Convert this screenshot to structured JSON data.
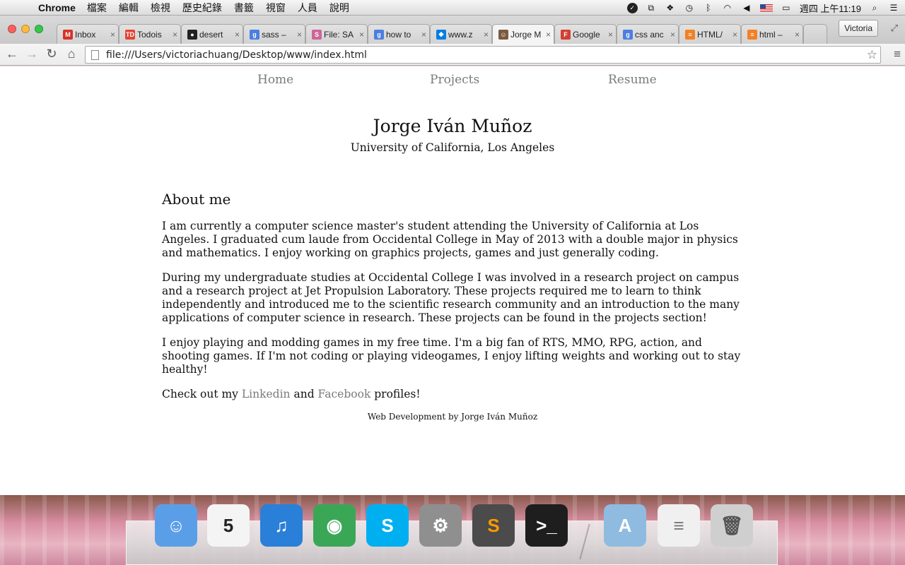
{
  "menubar": {
    "app_name": "Chrome",
    "items": [
      "檔案",
      "編輯",
      "檢視",
      "歷史紀錄",
      "書籤",
      "視窗",
      "人員",
      "說明"
    ],
    "clock": "週四 上午11:19"
  },
  "tabs": [
    {
      "label": "Inbox",
      "icon": "gmail-icon",
      "color": "#d93025",
      "glyph": "M"
    },
    {
      "label": "Todois",
      "icon": "todoist-icon",
      "color": "#e44332",
      "glyph": "TD"
    },
    {
      "label": "desert",
      "icon": "github-icon",
      "color": "#222222",
      "glyph": "●"
    },
    {
      "label": "sass –",
      "icon": "google-icon",
      "color": "#4a7fe0",
      "glyph": "g"
    },
    {
      "label": "File: SA",
      "icon": "sass-icon",
      "color": "#cf649a",
      "glyph": "S"
    },
    {
      "label": "how to",
      "icon": "google-icon",
      "color": "#4a7fe0",
      "glyph": "g"
    },
    {
      "label": "www.z",
      "icon": "dropbox-icon",
      "color": "#007ee5",
      "glyph": "◆"
    },
    {
      "label": "Jorge M",
      "icon": "avatar-icon",
      "color": "#7a5a40",
      "glyph": "☺"
    },
    {
      "label": "Google",
      "icon": "google-fonts-icon",
      "color": "#d23f31",
      "glyph": "F"
    },
    {
      "label": "css anc",
      "icon": "google-icon",
      "color": "#4a7fe0",
      "glyph": "g"
    },
    {
      "label": "HTML/",
      "icon": "stackoverflow-icon",
      "color": "#f48024",
      "glyph": "≡"
    },
    {
      "label": "html –",
      "icon": "stackoverflow-icon",
      "color": "#f48024",
      "glyph": "≡"
    }
  ],
  "profile_name": "Victoria",
  "address": "file:///Users/victoriachuang/Desktop/www/index.html",
  "site": {
    "nav": [
      "Home",
      "Projects",
      "Resume"
    ],
    "name": "Jorge Iván Muñoz",
    "school": "University of California, Los Angeles",
    "about_heading": "About me",
    "paragraphs": [
      "I am currently a computer science master's student attending the University of California at Los Angeles. I graduated cum laude from Occidental College in May of 2013 with a double major in physics and mathematics. I enjoy working on graphics projects, games and just generally coding.",
      "During my undergraduate studies at Occidental College I was involved in a research project on campus and a research project at Jet Propulsion Laboratory. These projects required me to learn to think independently and introduced me to the scientific research community and an introduction to the many applications of computer science in research. These projects can be found in the projects section!",
      "I enjoy playing and modding games in my free time. I'm a big fan of RTS, MMO, RPG, action, and shooting games. If I'm not coding or playing videogames, I enjoy lifting weights and working out to stay healthy!"
    ],
    "checkout": {
      "prefix": "Check out my ",
      "link1": "Linkedin",
      "middle": " and ",
      "link2": "Facebook",
      "suffix": " profiles!"
    },
    "footer": "Web Development by Jorge Iván Muñoz",
    "link_color": "#7a7a7a"
  },
  "dock": [
    {
      "name": "finder-icon",
      "color": "#5b9ee8",
      "glyph": "☺"
    },
    {
      "name": "calendar-icon",
      "color": "#f4f4f4",
      "glyph": "5",
      "text_color": "#222"
    },
    {
      "name": "itunes-icon",
      "color": "#2a7fd8",
      "glyph": "♫"
    },
    {
      "name": "chrome-icon",
      "color": "#3aa757",
      "glyph": "◉"
    },
    {
      "name": "skype-icon",
      "color": "#00aff0",
      "glyph": "S"
    },
    {
      "name": "system-preferences-icon",
      "color": "#8f8f8f",
      "glyph": "⚙"
    },
    {
      "name": "sublime-text-icon",
      "color": "#4b4b4b",
      "glyph": "S",
      "text_color": "#ff9800"
    },
    {
      "name": "terminal-icon",
      "color": "#1e1e1e",
      "glyph": ">_"
    },
    {
      "name": "applications-folder-icon",
      "color": "#8fbbe0",
      "glyph": "A"
    },
    {
      "name": "documents-stack-icon",
      "color": "#f0f0f0",
      "glyph": "≡",
      "text_color": "#777"
    },
    {
      "name": "trash-icon",
      "color": "#cfcfcf",
      "glyph": "🗑",
      "text_color": "#555"
    }
  ]
}
